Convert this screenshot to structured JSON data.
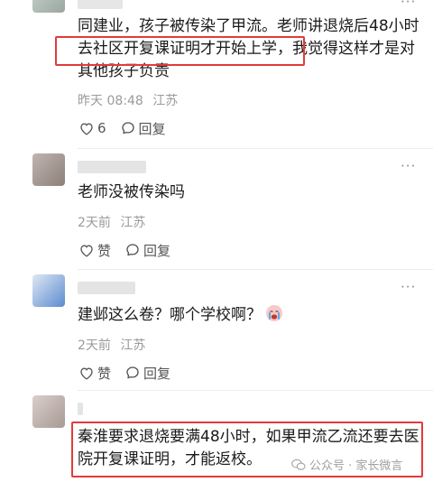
{
  "comments": [
    {
      "text": "同建业，孩子被传染了甲流。老师讲退烧后48小时去社区开复课证明才开始上学，我觉得这样才是对其他孩子负责",
      "time": "昨天 08:48",
      "location": "江苏",
      "like_label": "6",
      "reply_label": "回复"
    },
    {
      "text": "老师没被传染吗",
      "time": "2天前",
      "location": "江苏",
      "like_label": "赞",
      "reply_label": "回复"
    },
    {
      "text": "建邺这么卷？哪个学校啊？",
      "time": "2天前",
      "location": "江苏",
      "like_label": "赞",
      "reply_label": "回复"
    },
    {
      "text": "秦淮要求退烧要满48小时，如果甲流乙流还要去医院开复课证明，才能返校。"
    }
  ],
  "more_glyph": "···",
  "watermark": "公众号 · 家长微言",
  "icons": [
    "heart-icon",
    "comment-bubble-icon",
    "more-dots-icon",
    "crying-emoji-icon",
    "wechat-logo-icon"
  ],
  "colors": {
    "highlight": "#e23b3b",
    "meta": "#9a9a9a",
    "text": "#1a1a1a"
  }
}
